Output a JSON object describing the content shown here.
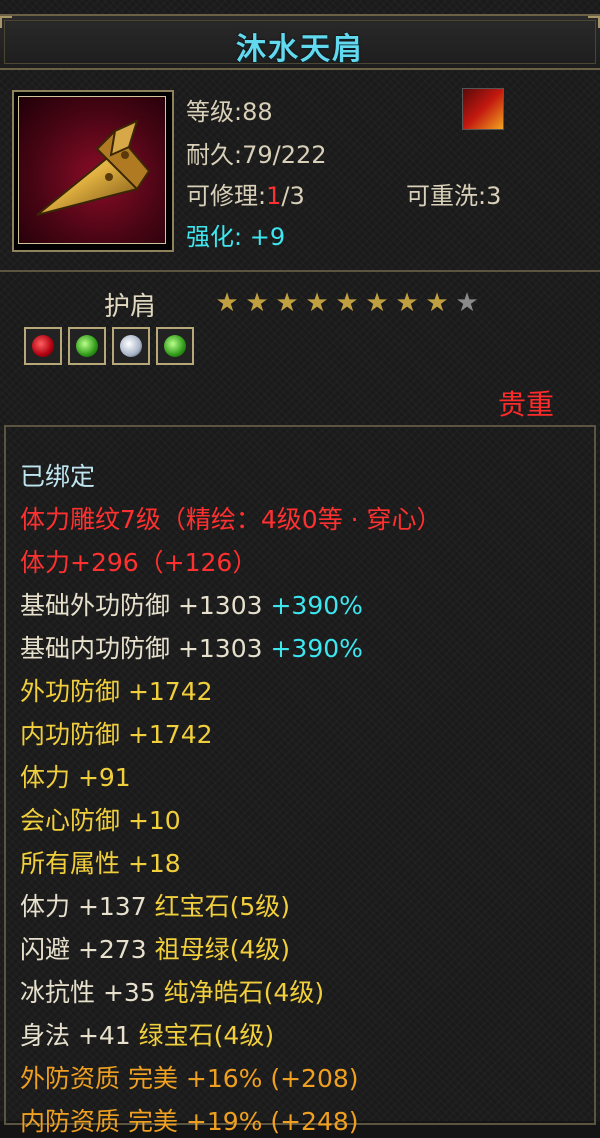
{
  "title": "沐水天肩",
  "item": {
    "level_label": "等级:88",
    "durability_label": "耐久:79/222",
    "repair_prefix": "可修理:",
    "repair_current": "1",
    "repair_total": "/3",
    "rewash_label": "可重洗:3",
    "enhance_label": "强化: +9"
  },
  "type_label": "护肩",
  "stars": {
    "filled": 8,
    "total": 9
  },
  "gems": [
    "red-gem-icon",
    "green-gem-icon",
    "white-gem-icon",
    "green-gem-icon"
  ],
  "rarity": "贵重",
  "attributes": [
    {
      "parts": [
        {
          "text": "已绑定",
          "color": "lb"
        }
      ]
    },
    {
      "parts": [
        {
          "text": "体力雕纹7级（精绘：4级0等 · 穿心）",
          "color": "r"
        }
      ]
    },
    {
      "parts": [
        {
          "text": "体力+296（+126）",
          "color": "r"
        }
      ]
    },
    {
      "parts": [
        {
          "text": "基础外功防御 +1303 ",
          "color": "w"
        },
        {
          "text": "+390%",
          "color": "c"
        }
      ]
    },
    {
      "parts": [
        {
          "text": "基础内功防御 +1303 ",
          "color": "w"
        },
        {
          "text": "+390%",
          "color": "c"
        }
      ]
    },
    {
      "parts": [
        {
          "text": "外功防御 +1742",
          "color": "y"
        }
      ]
    },
    {
      "parts": [
        {
          "text": "内功防御 +1742",
          "color": "y"
        }
      ]
    },
    {
      "parts": [
        {
          "text": "体力 +91",
          "color": "y"
        }
      ]
    },
    {
      "parts": [
        {
          "text": "会心防御 +10",
          "color": "y"
        }
      ]
    },
    {
      "parts": [
        {
          "text": "所有属性 +18",
          "color": "y"
        }
      ]
    },
    {
      "parts": [
        {
          "text": "体力 +137 ",
          "color": "w"
        },
        {
          "text": "红宝石(5级)",
          "color": "y"
        }
      ]
    },
    {
      "parts": [
        {
          "text": "闪避 +273 ",
          "color": "w"
        },
        {
          "text": "祖母绿(4级)",
          "color": "y"
        }
      ]
    },
    {
      "parts": [
        {
          "text": "冰抗性 +35 ",
          "color": "w"
        },
        {
          "text": "纯净皓石(4级)",
          "color": "y"
        }
      ]
    },
    {
      "parts": [
        {
          "text": "身法 +41 ",
          "color": "w"
        },
        {
          "text": "绿宝石(4级)",
          "color": "y"
        }
      ]
    },
    {
      "parts": [
        {
          "text": "外防资质  完美 +16% (+208)",
          "color": "o"
        }
      ]
    },
    {
      "parts": [
        {
          "text": "内防资质  完美 +19% (+248)",
          "color": "o"
        }
      ]
    }
  ],
  "colors": {
    "title": "#63d9ef",
    "rarity": "#ff2b2b",
    "enhance": "#3ee6f0",
    "star_on": "#c0a040",
    "star_off": "#8a8a8a"
  }
}
